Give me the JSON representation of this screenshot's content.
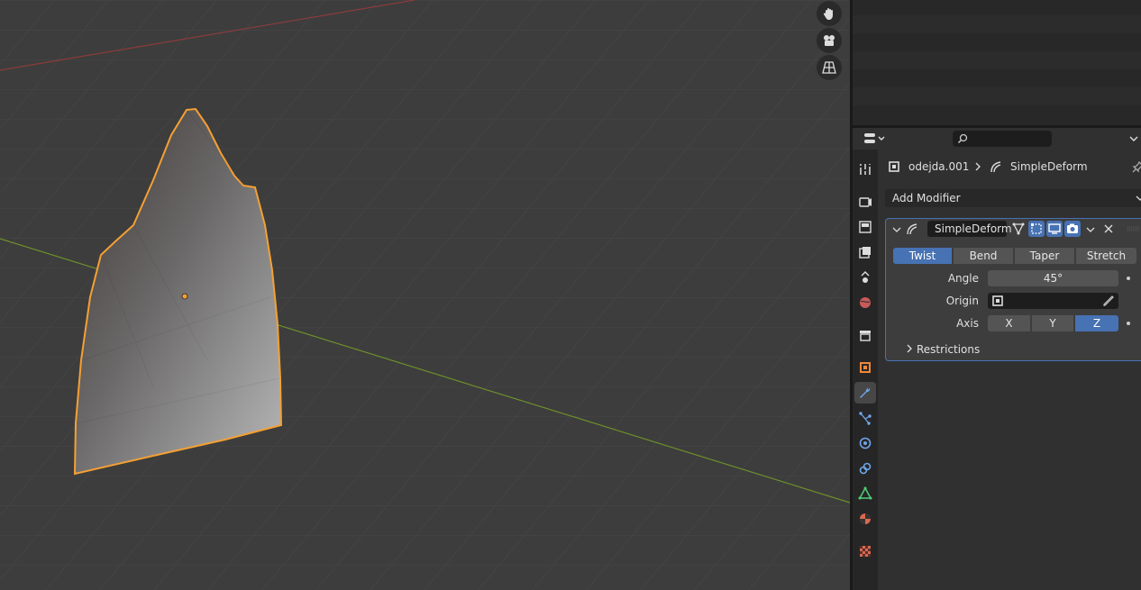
{
  "outliner": {},
  "properties": {
    "search": {
      "placeholder": ""
    },
    "breadcrumb": {
      "object_name": "odejda.001",
      "modifier_name": "SimpleDeform"
    },
    "add_modifier_label": "Add Modifier",
    "modifier": {
      "name": "SimpleDeform",
      "modes": [
        "Twist",
        "Bend",
        "Taper",
        "Stretch"
      ],
      "active_mode": "Twist",
      "angle_label": "Angle",
      "angle_value": "45°",
      "origin_label": "Origin",
      "origin_value": "",
      "axis_label": "Axis",
      "axes": [
        "X",
        "Y",
        "Z"
      ],
      "active_axis": "Z",
      "restrictions_label": "Restrictions"
    },
    "tabs": [
      "tool",
      "render",
      "output",
      "view-layer",
      "scene",
      "world",
      "collection",
      "object",
      "modifiers",
      "particles",
      "physics",
      "constraints",
      "data",
      "material",
      "texture"
    ],
    "active_tab": "modifiers"
  },
  "colors": {
    "selection_outline": "#f5a033",
    "x_axis": "#8c3b3b",
    "y_axis": "#6e8f2a",
    "active_blue": "#4772b3"
  }
}
